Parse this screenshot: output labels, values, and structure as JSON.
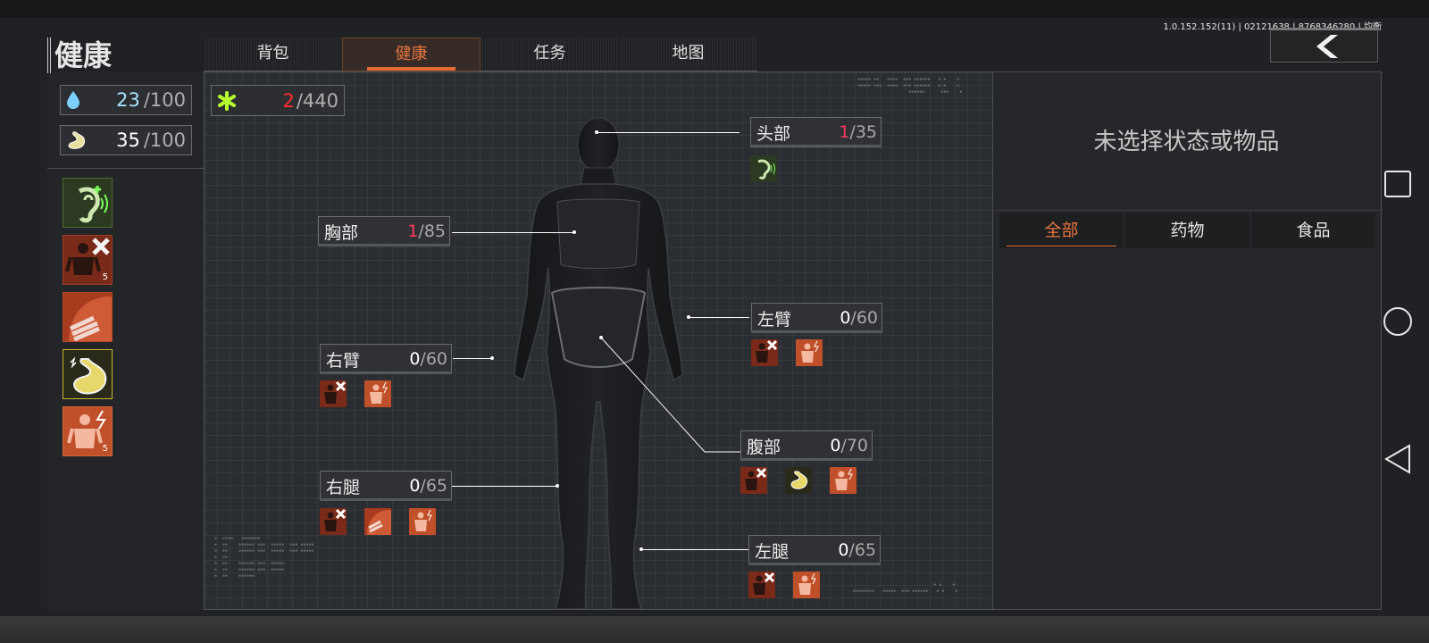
{
  "version": "1.0.152.152(11) | 02121638 | 8768346280 | 均衡",
  "page_title": "健康",
  "tabs": [
    {
      "label": "背包",
      "active": false
    },
    {
      "label": "健康",
      "active": true
    },
    {
      "label": "任务",
      "active": false
    },
    {
      "label": "地图",
      "active": false
    }
  ],
  "stats": {
    "water": {
      "value": "23",
      "max": "/100",
      "icon": "water-drop-icon",
      "color": "#a6e3ff"
    },
    "food": {
      "value": "35",
      "max": "/100",
      "icon": "stomach-icon"
    }
  },
  "total_health": {
    "value": "2",
    "max": "/440",
    "icon": "health-cross-icon",
    "color": "#ff2e2e"
  },
  "status_effects": [
    {
      "icon": "tinnitus-icon",
      "count": ""
    },
    {
      "icon": "fracture-icon",
      "count": "5"
    },
    {
      "icon": "bandage-icon",
      "count": ""
    },
    {
      "icon": "nausea-icon",
      "count": ""
    },
    {
      "icon": "pain-icon",
      "count": "5"
    }
  ],
  "body_parts": {
    "head": {
      "name": "头部",
      "cur": "1",
      "max": "/35"
    },
    "chest": {
      "name": "胸部",
      "cur": "1",
      "max": "/85"
    },
    "left_arm": {
      "name": "左臂",
      "cur": "0",
      "max": "/60"
    },
    "right_arm": {
      "name": "右臂",
      "cur": "0",
      "max": "/60"
    },
    "stomach": {
      "name": "腹部",
      "cur": "0",
      "max": "/70"
    },
    "right_leg": {
      "name": "右腿",
      "cur": "0",
      "max": "/65"
    },
    "left_leg": {
      "name": "左腿",
      "cur": "0",
      "max": "/65"
    }
  },
  "detail_panel": {
    "empty_text": "未选择状态或物品",
    "filters": [
      {
        "label": "全部",
        "active": true
      },
      {
        "label": "药物",
        "active": false
      },
      {
        "label": "食品",
        "active": false
      }
    ]
  },
  "colors": {
    "accent": "#e8763f",
    "hurt": "#ff3b5a",
    "fracture_bg": "#8a2f1a",
    "pain_bg": "#c8502a",
    "nausea_bg": "#3a3a20"
  }
}
